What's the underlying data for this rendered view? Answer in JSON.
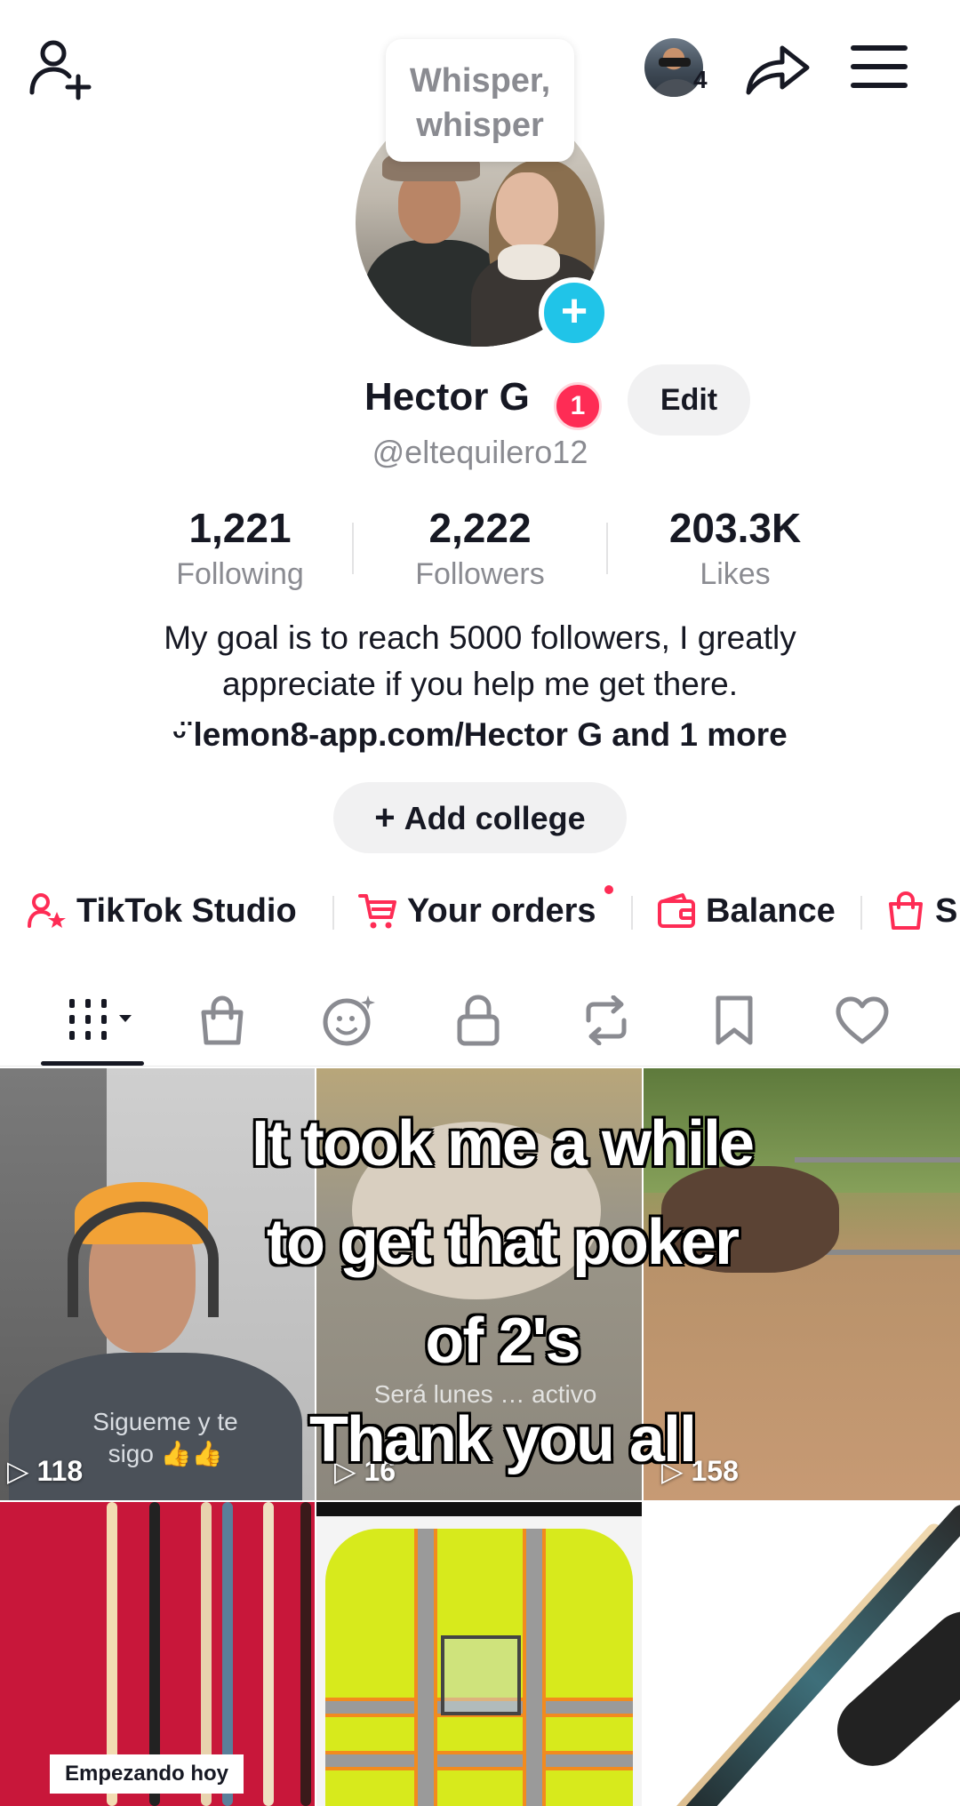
{
  "whisper": {
    "line1": "Whisper,",
    "line2": "whisper"
  },
  "header": {
    "story_count": "4"
  },
  "profile": {
    "name": "Hector G",
    "badge_count": "1",
    "edit_label": "Edit",
    "username": "@eltequilero12"
  },
  "stats": [
    {
      "value": "1,221",
      "label": "Following"
    },
    {
      "value": "2,222",
      "label": "Followers"
    },
    {
      "value": "203.3K",
      "label": "Likes"
    }
  ],
  "bio": {
    "line1": "My goal is to reach 5000 followers, I greatly",
    "line2": "appreciate if you help me get there.",
    "link": "lemon8-app.com/Hector G and 1 more",
    "add_college": "Add college"
  },
  "shortcuts": [
    {
      "label": "TikTok Studio",
      "icon": "person-star-icon"
    },
    {
      "label": "Your orders",
      "icon": "cart-icon"
    },
    {
      "label": "Balance",
      "icon": "wallet-icon"
    },
    {
      "label": "S",
      "icon": "shopping-bag-icon"
    }
  ],
  "tabs": [
    "videos-grid-icon",
    "shop-bag-icon",
    "creator-face-icon",
    "lock-icon",
    "repost-icon",
    "bookmark-icon",
    "heart-icon"
  ],
  "videos": [
    {
      "views": "118",
      "overlay": "Sigueme y te sigo 👍👍"
    },
    {
      "views": "16",
      "overlay": "Será lunes … activo"
    },
    {
      "views": "158"
    },
    {
      "label": "Empezando hoy"
    },
    {},
    {}
  ],
  "caption": {
    "line1": "It took me a while",
    "line2": "to get that poker",
    "line3": "of 2's",
    "line4": "Thank you all"
  },
  "colors": {
    "accent_red": "#fe2c55",
    "accent_cyan": "#20c4e8",
    "text": "#161823",
    "muted": "#8a8b91"
  }
}
